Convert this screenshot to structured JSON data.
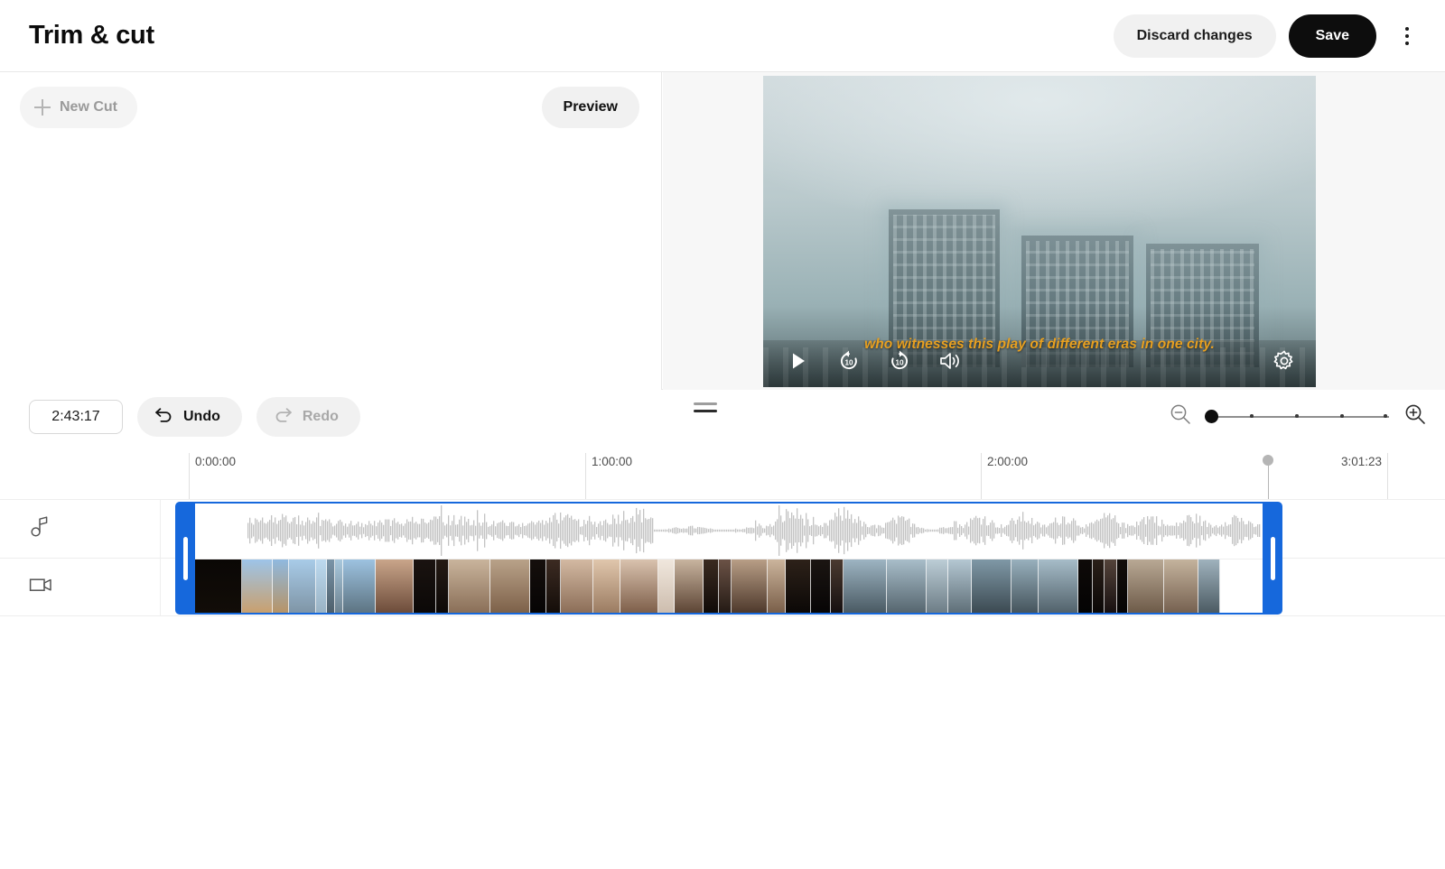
{
  "header": {
    "title": "Trim & cut",
    "discard_label": "Discard changes",
    "save_label": "Save",
    "menu_icon": "kebab-menu-icon"
  },
  "cuts_panel": {
    "new_cut_label": "New Cut",
    "new_cut_enabled": false,
    "preview_label": "Preview"
  },
  "player": {
    "subtitle": "who witnesses this play of different eras in one city.",
    "controls": [
      {
        "name": "play-button",
        "icon": "play-icon"
      },
      {
        "name": "rewind-10-button",
        "icon": "replay-10-icon",
        "label": "10"
      },
      {
        "name": "forward-10-button",
        "icon": "forward-10-icon",
        "label": "10"
      },
      {
        "name": "volume-button",
        "icon": "volume-icon"
      },
      {
        "name": "settings-button",
        "icon": "gear-icon"
      }
    ]
  },
  "toolbar": {
    "current_time": "2:43:17",
    "undo_label": "Undo",
    "redo_label": "Redo",
    "undo_enabled": true,
    "redo_enabled": false,
    "zoom_out_icon": "zoom-out-icon",
    "zoom_in_icon": "zoom-in-icon",
    "zoom_value": 0
  },
  "timeline": {
    "ruler_labels": [
      "0:00:00",
      "1:00:00",
      "2:00:00",
      "3:01:23"
    ],
    "duration_label": "3:01:23",
    "playhead_time": "2:43:17",
    "tracks": [
      {
        "name": "audio-track",
        "icon": "music-note-icon"
      },
      {
        "name": "video-track",
        "icon": "video-camera-icon"
      }
    ],
    "selection": {
      "start_label": "0:00:00",
      "end_label": "3:01:23"
    }
  },
  "colors": {
    "accent": "#1668dc",
    "save_bg": "#0d0d0d",
    "subtitle": "#e8a020",
    "waveform": "#c3c3c3",
    "disabled_text": "#9a9a9a"
  }
}
